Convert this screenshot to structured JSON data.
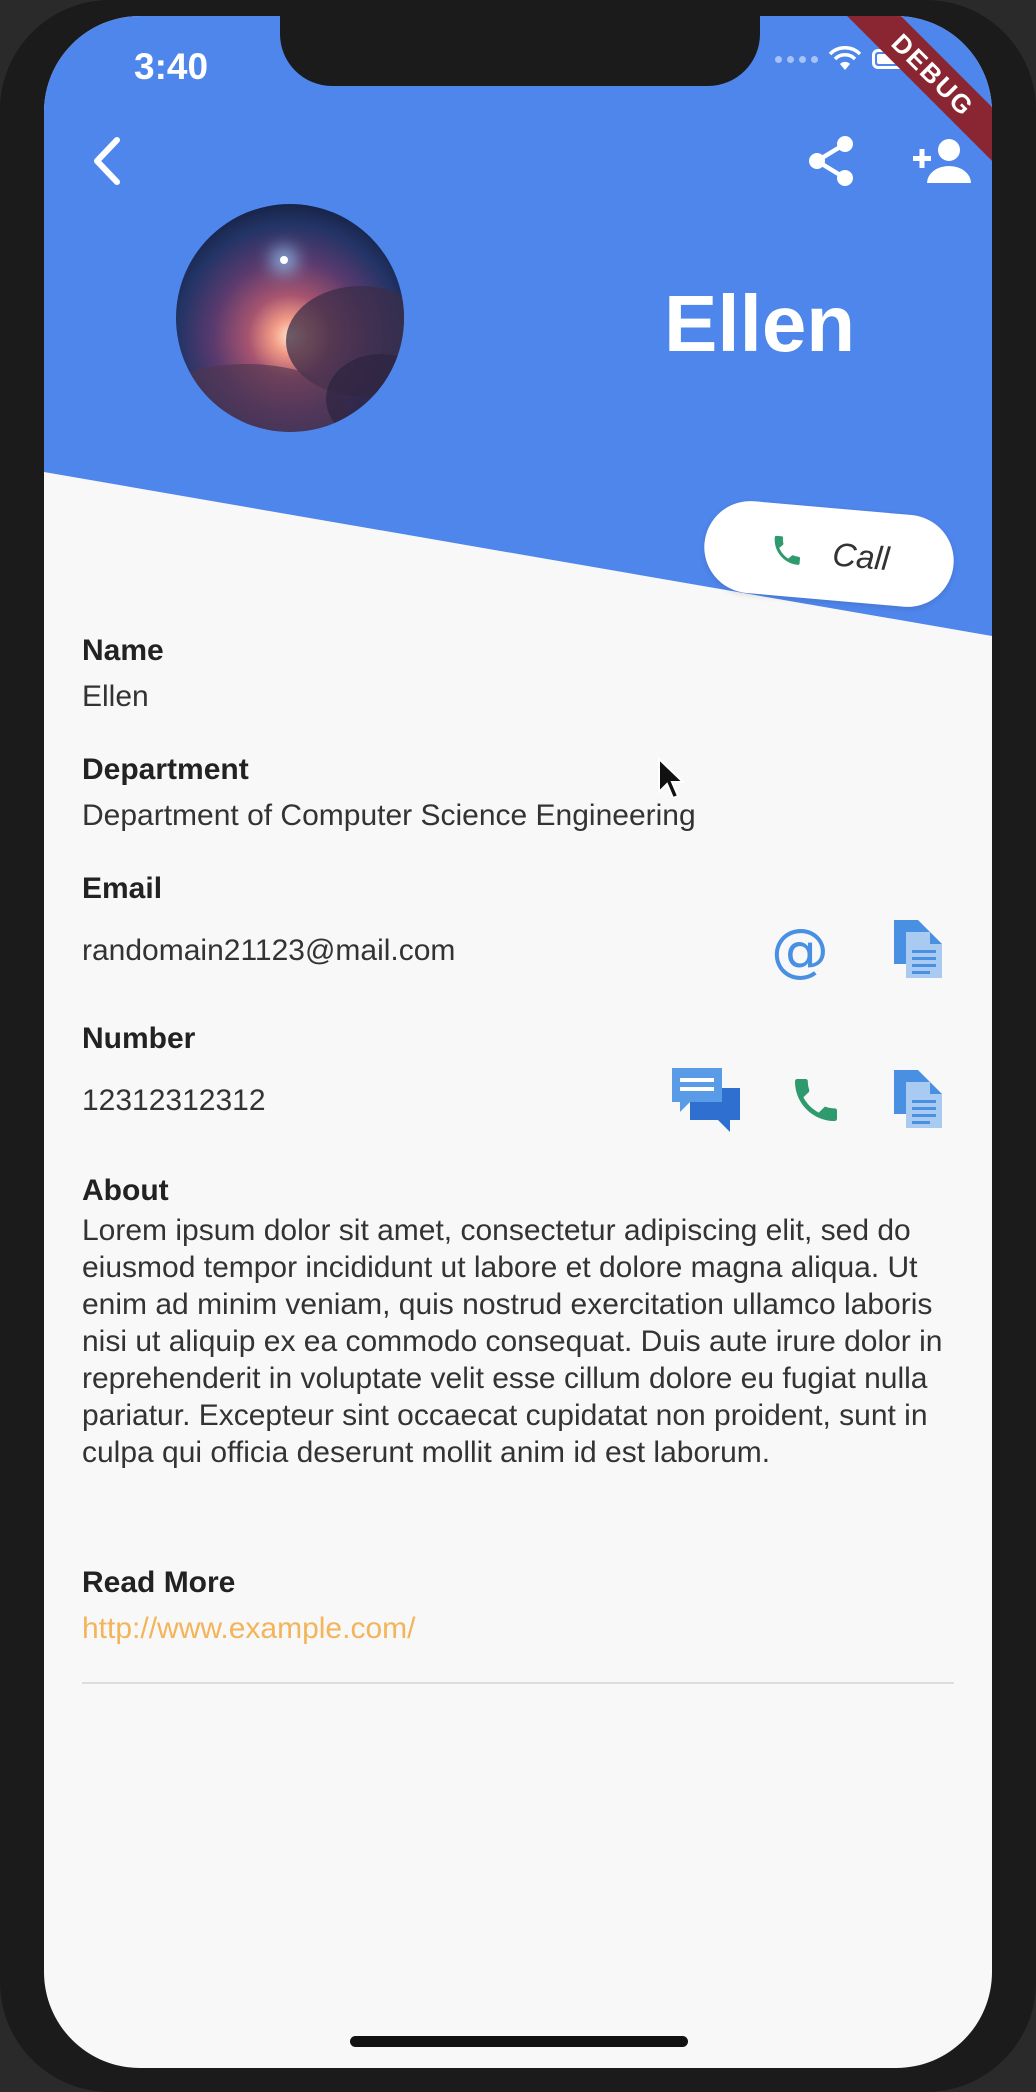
{
  "status_bar": {
    "time": "3:40"
  },
  "debug_banner": "DEBUG",
  "header": {
    "back_icon": "back-chevron-icon",
    "share_icon": "share-icon",
    "add_contact_icon": "person-add-icon",
    "name": "Ellen",
    "call_button": {
      "icon": "phone-icon",
      "label": "Call"
    }
  },
  "fields": {
    "name": {
      "label": "Name",
      "value": "Ellen"
    },
    "department": {
      "label": "Department",
      "value": "Department of Computer Science Engineering"
    },
    "email": {
      "label": "Email",
      "value": "randomain21123@mail.com",
      "actions": [
        "at-sign-icon",
        "copy-icon"
      ]
    },
    "number": {
      "label": "Number",
      "value": "12312312312",
      "actions": [
        "message-icon",
        "phone-icon",
        "copy-icon"
      ]
    },
    "about": {
      "label": "About",
      "value": "Lorem ipsum dolor sit amet, consectetur adipiscing elit, sed do eiusmod tempor incididunt ut labore et dolore magna aliqua. Ut enim ad minim veniam, quis nostrud exercitation ullamco laboris nisi ut aliquip ex ea commodo consequat. Duis aute irure dolor in reprehenderit in voluptate velit esse cillum dolore eu fugiat nulla pariatur. Excepteur sint occaecat cupidatat non proident, sunt in culpa qui officia deserunt mollit anim id est laborum."
    },
    "read_more": {
      "label": "Read More",
      "value": "http://www.example.com/"
    }
  },
  "colors": {
    "header_blue": "#4f86ec",
    "icon_blue": "#4a90e2",
    "call_green": "#2e9a6e",
    "link_orange": "#f3b45a",
    "debug_red": "#8a2631"
  }
}
